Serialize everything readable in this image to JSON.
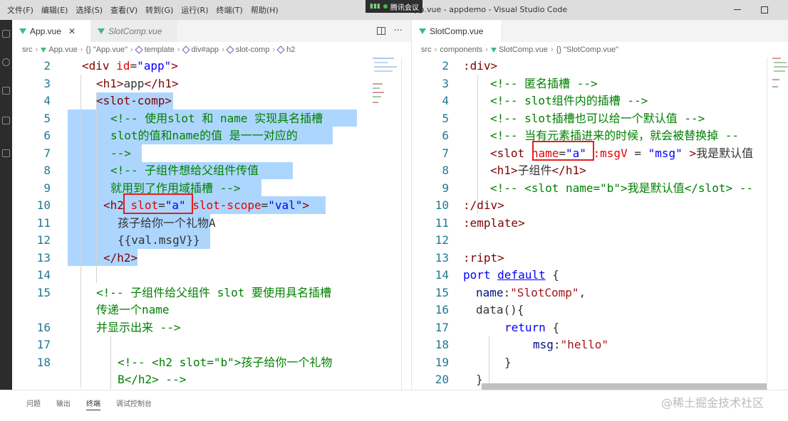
{
  "menu": [
    "文件(F)",
    "编辑(E)",
    "选择(S)",
    "查看(V)",
    "转到(G)",
    "运行(R)",
    "终端(T)",
    "帮助(H)"
  ],
  "meeting_badge": "腾讯会议",
  "window_title": "App.vue - appdemo - Visual Studio Code",
  "left": {
    "tabs": [
      "App.vue",
      "SlotComp.vue"
    ],
    "close_glyph": "✕",
    "more_glyph": "···",
    "breadcrumb": [
      "src",
      "App.vue",
      "{} \"App.vue\"",
      "template",
      "div#app",
      "slot-comp",
      "h2"
    ],
    "lines": [
      {
        "n": "2",
        "text": "<div id=\"app\">"
      },
      {
        "n": "3",
        "text": "<h1>app</h1>"
      },
      {
        "n": "4",
        "text": "<slot-comp>"
      },
      {
        "n": "5",
        "text": "<!-- 使用slot 和 name 实现具名插槽"
      },
      {
        "n": "6",
        "text": "slot的值和name的值 是一一对应的"
      },
      {
        "n": "7",
        "text": "-->"
      },
      {
        "n": "8",
        "text": "<!-- 子组件想给父组件传值"
      },
      {
        "n": "9",
        "text": "就用到了作用域插槽 -->"
      },
      {
        "n": "10",
        "text": "<h2 slot=\"a\" slot-scope=\"val\">"
      },
      {
        "n": "11",
        "text": "孩子给你一个礼物A"
      },
      {
        "n": "12",
        "text": "{{val.msgV}}"
      },
      {
        "n": "13",
        "text": "</h2>"
      },
      {
        "n": "14",
        "text": ""
      },
      {
        "n": "15",
        "text": "<!-- 子组件给父组件 slot 要使用具名插槽"
      },
      {
        "n": "",
        "text": "传递一个name"
      },
      {
        "n": "16",
        "text": "并显示出来 -->"
      },
      {
        "n": "17",
        "text": ""
      },
      {
        "n": "18",
        "text": "<!-- <h2 slot=\"b\">孩子给你一个礼物"
      },
      {
        "n": "",
        "text": "B</h2> -->"
      }
    ]
  },
  "right": {
    "tabs": [
      "SlotComp.vue"
    ],
    "breadcrumb": [
      "src",
      "components",
      "SlotComp.vue",
      "{} \"SlotComp.vue\""
    ],
    "lines": [
      {
        "n": "2",
        "text": ":div>"
      },
      {
        "n": "3",
        "text": "<!-- 匿名插槽 -->"
      },
      {
        "n": "4",
        "text": "<!-- slot组件内的插槽 -->"
      },
      {
        "n": "5",
        "text": "<!-- slot插槽也可以给一个默认值 -->"
      },
      {
        "n": "6",
        "text": "<!-- 当有元素插进来的时候，就会被替换掉 --"
      },
      {
        "n": "7",
        "text": "<slot name=\"a\" :msgV = \"msg\" >我是默认值"
      },
      {
        "n": "8",
        "text": "<h1>子组件</h1>"
      },
      {
        "n": "9",
        "text": "<!-- <slot name=\"b\">我是默认值</slot> --"
      },
      {
        "n": "10",
        "text": ":/div>"
      },
      {
        "n": "11",
        "text": ":emplate>"
      },
      {
        "n": "12",
        "text": ""
      },
      {
        "n": "13",
        "text": ":ript>"
      },
      {
        "n": "14",
        "text": "port default {"
      },
      {
        "n": "15",
        "text": "name:\"SlotComp\","
      },
      {
        "n": "16",
        "text": "data(){"
      },
      {
        "n": "17",
        "text": "return {"
      },
      {
        "n": "18",
        "text": "msg:\"hello\""
      },
      {
        "n": "19",
        "text": "}"
      },
      {
        "n": "20",
        "text": "}"
      }
    ]
  },
  "panel": {
    "tabs": [
      "问题",
      "输出",
      "终端",
      "调试控制台"
    ],
    "active_tab": "终端"
  },
  "watermark": "@稀土掘金技术社区",
  "colors": {
    "tag": "#800000",
    "attribute": "#e50000",
    "string": "#0000ff",
    "comment": "#008000",
    "keyword": "#0000ff",
    "selection": "#add6ff",
    "annotation_box": "#e02020",
    "line_number": "#237893",
    "vue_icon": "#41b883"
  }
}
